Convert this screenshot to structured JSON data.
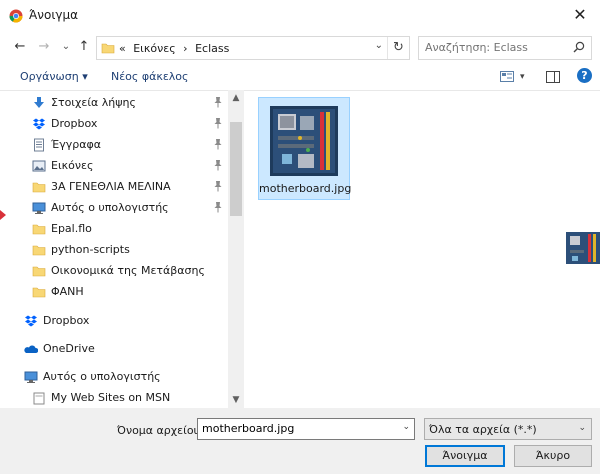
{
  "window": {
    "title": "Άνοιγμα",
    "close_glyph": "✕"
  },
  "nav": {
    "back": "←",
    "forward": "→",
    "recent": "⌄",
    "up": "↑"
  },
  "address": {
    "crumbs": [
      "«",
      "Εικόνες",
      "›",
      "Eclass"
    ],
    "dropdown": "⌄",
    "refresh": "↻"
  },
  "search": {
    "placeholder": "Αναζήτηση: Eclass"
  },
  "toolbar": {
    "organize": "Οργάνωση ▾",
    "new_folder": "Νέος φάκελος",
    "view_menu": "▾",
    "help": "?"
  },
  "sidebar": {
    "items": [
      {
        "label": "Στοιχεία λήψης",
        "icon": "download-icon",
        "pinned": true
      },
      {
        "label": "Dropbox",
        "icon": "dropbox-icon",
        "pinned": true
      },
      {
        "label": "Έγγραφα",
        "icon": "documents-icon",
        "pinned": true
      },
      {
        "label": "Εικόνες",
        "icon": "pictures-icon",
        "pinned": true
      },
      {
        "label": "3Α ΓΕΝΕΘΛΙΑ ΜΕΛΙΝΑ",
        "icon": "folder-icon",
        "pinned": true
      },
      {
        "label": "Αυτός ο υπολογιστής",
        "icon": "computer-icon",
        "pinned": true
      },
      {
        "label": "Epal.flo",
        "icon": "folder-icon",
        "pinned": false
      },
      {
        "label": "python-scripts",
        "icon": "folder-icon",
        "pinned": false
      },
      {
        "label": "Οικονομικά της Μετάβασης",
        "icon": "folder-icon",
        "pinned": false
      },
      {
        "label": "ΦΑΝΗ",
        "icon": "folder-icon",
        "pinned": false
      },
      {
        "label": "Dropbox",
        "icon": "dropbox-icon",
        "pinned": false
      },
      {
        "label": "OneDrive",
        "icon": "onedrive-icon",
        "pinned": false
      },
      {
        "label": "Αυτός ο υπολογιστής",
        "icon": "computer-icon",
        "pinned": false
      },
      {
        "label": "My Web Sites on MSN",
        "icon": "web-folder-icon",
        "pinned": false
      }
    ]
  },
  "files": [
    {
      "name": "motherboard.jpg",
      "selected": true
    }
  ],
  "footer": {
    "filename_label": "Όνομα αρχείου:",
    "filename_value": "motherboard.jpg",
    "filetype_value": "Όλα τα αρχεία (*.*)",
    "open_label": "Άνοιγμα",
    "cancel_label": "Άκυρο"
  },
  "colors": {
    "accent": "#0078d7",
    "selection": "#cce8ff",
    "link": "#1e3f73",
    "folder": "#f8d775"
  }
}
